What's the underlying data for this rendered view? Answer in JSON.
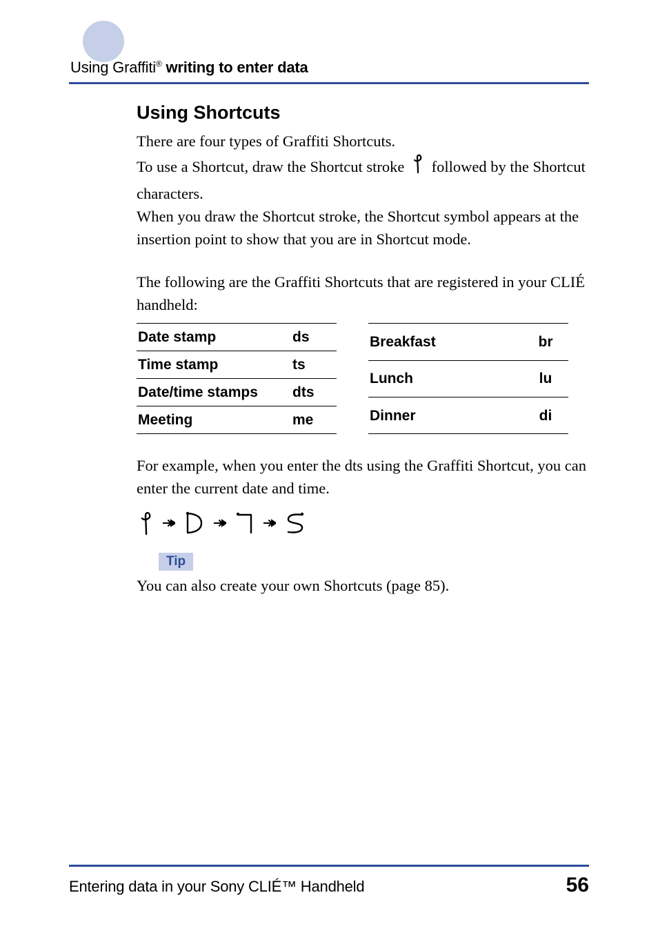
{
  "header": {
    "prefix": "Using Graffiti",
    "reg": "®",
    "suffix": " writing to enter data"
  },
  "section": {
    "title": "Using Shortcuts",
    "p1": "There are four types of Graffiti Shortcuts.",
    "p2a": "To use a Shortcut, draw the Shortcut stroke ",
    "p2b": " followed by the Shortcut characters.",
    "p3": "When you draw the Shortcut stroke, the Shortcut symbol appears at the insertion point to show that you are in Shortcut mode.",
    "p4": "The following are the Graffiti Shortcuts that are registered in your CLIÉ handheld:",
    "p5": "For example, when you enter the dts using the Graffiti Shortcut, you can enter the current date and time.",
    "tip_label": "Tip",
    "tip_text": "You can also create your own Shortcuts (page 85)."
  },
  "tables": {
    "left": [
      {
        "name": "Date stamp",
        "code": "ds"
      },
      {
        "name": "Time stamp",
        "code": "ts"
      },
      {
        "name": "Date/time stamps",
        "code": "dts"
      },
      {
        "name": "Meeting",
        "code": "me"
      }
    ],
    "right": [
      {
        "name": "Breakfast",
        "code": "br"
      },
      {
        "name": "Lunch",
        "code": "lu"
      },
      {
        "name": "Dinner",
        "code": "di"
      }
    ]
  },
  "footer": {
    "title": "Entering data in your Sony CLIÉ™ Handheld",
    "page": "56"
  },
  "icons": {
    "shortcut_stroke": "shortcut-stroke-glyph",
    "arrow": "right-arrow-glyph",
    "graffiti_d": "graffiti-d-glyph",
    "graffiti_t": "graffiti-t-glyph",
    "graffiti_s": "graffiti-s-glyph"
  }
}
